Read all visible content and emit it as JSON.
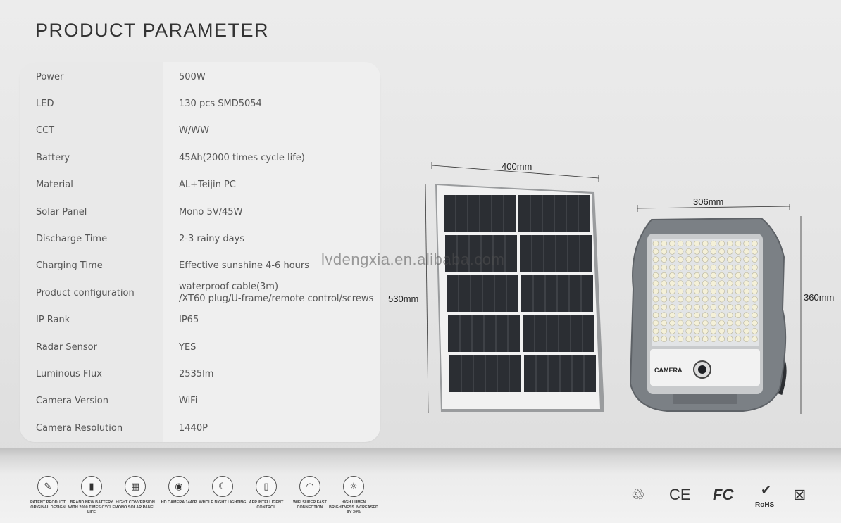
{
  "title": "PRODUCT PARAMETER",
  "parameters": [
    {
      "label": "Power",
      "value": "500W"
    },
    {
      "label": "LED",
      "value": "130 pcs SMD5054"
    },
    {
      "label": "CCT",
      "value": "W/WW"
    },
    {
      "label": "Battery",
      "value": "45Ah(2000 times cycle life)"
    },
    {
      "label": "Material",
      "value": "AL+Teijin PC"
    },
    {
      "label": "Solar Panel",
      "value": "Mono 5V/45W"
    },
    {
      "label": "Discharge Time",
      "value": "2-3 rainy days"
    },
    {
      "label": "Charging Time",
      "value": "Effective sunshine 4-6 hours"
    },
    {
      "label": "Product configuration",
      "value": "waterproof cable(3m)",
      "value2": "/XT60 plug/U-frame/remote control/screws"
    },
    {
      "label": "IP Rank",
      "value": "IP65"
    },
    {
      "label": "Radar Sensor",
      "value": "YES"
    },
    {
      "label": "Luminous Flux",
      "value": "2535lm"
    },
    {
      "label": "Camera Version",
      "value": "WiFi"
    },
    {
      "label": "Camera Resolution",
      "value": "1440P"
    }
  ],
  "dimensions": {
    "panel_width": "400mm",
    "panel_height": "530mm",
    "light_width": "306mm",
    "light_height": "360mm"
  },
  "light_labels": {
    "camera": "CAMERA"
  },
  "watermark": "lvdengxia.en.alibaba.com",
  "features": [
    {
      "icon": "patent-icon",
      "glyph": "✎",
      "caption": "PATENT PRODUCT ORIGINAL DESIGN"
    },
    {
      "icon": "battery-icon",
      "glyph": "▮",
      "caption": "BRAND NEW BATTERY WITH 2000 TIMES CYCLE LIFE"
    },
    {
      "icon": "solar-panel-icon",
      "glyph": "▦",
      "caption": "HIGHT CONVERSION MONO SOLAR PANEL"
    },
    {
      "icon": "camera-icon",
      "glyph": "◉",
      "caption": "HD CAMERA 1440P"
    },
    {
      "icon": "night-light-icon",
      "glyph": "☾",
      "caption": "WHOLE NIGHT LIGHTING"
    },
    {
      "icon": "app-control-icon",
      "glyph": "▯",
      "caption": "APP INTELLIGENT CONTROL"
    },
    {
      "icon": "wifi-icon",
      "glyph": "◠",
      "caption": "WIFI SUPER FAST CONNECTION"
    },
    {
      "icon": "brightness-icon",
      "glyph": "☼",
      "caption": "HIGH LUMEN BRIGHTNESS INCREASED BY 30%"
    }
  ],
  "certifications": {
    "recycle": "♲",
    "ce": "CE",
    "fc": "FC",
    "rohs": "RoHS",
    "weee": "⊠"
  },
  "colors": {
    "frame": "#8a8d8f",
    "cell": "#2b2e33",
    "light_body": "#7b8085",
    "led": "#f4f0d8"
  }
}
